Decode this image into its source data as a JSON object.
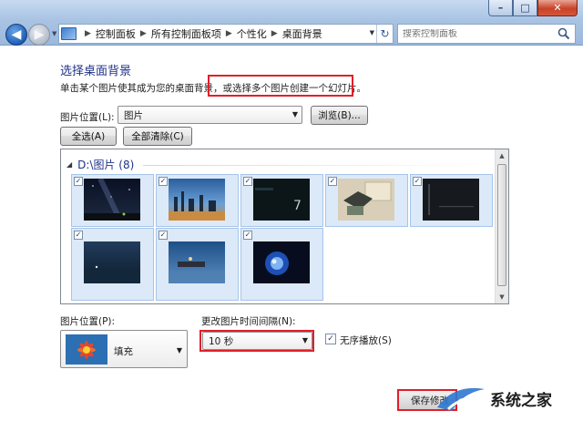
{
  "window": {
    "controls": [
      "–",
      "□",
      "✕"
    ]
  },
  "address_bar": {
    "breadcrumbs": [
      "控制面板",
      "所有控制面板项",
      "个性化",
      "桌面背景"
    ]
  },
  "search": {
    "placeholder": "搜索控制面板"
  },
  "page": {
    "title": "选择桌面背景",
    "subtitle_part1": "单击某个图片使其成为您的桌面背景，",
    "subtitle_part2": "或选择多个图片创建一个幻灯片。"
  },
  "picture_location": {
    "label": "图片位置(L):",
    "value": "图片",
    "browse_label": "浏览(B)..."
  },
  "select_buttons": {
    "select_all": "全选(A)",
    "clear_all": "全部清除(C)"
  },
  "gallery": {
    "group_title": "D:\\图片 (8)",
    "images": [
      {
        "name": "starry-night-wallpaper",
        "checked": true
      },
      {
        "name": "city-skyline-wallpaper",
        "checked": true
      },
      {
        "name": "windows-7-dark-wallpaper",
        "checked": true
      },
      {
        "name": "map-collage-wallpaper",
        "checked": true
      },
      {
        "name": "dark-abstract-wallpaper",
        "checked": true
      },
      {
        "name": "misty-lake-wallpaper",
        "checked": true
      },
      {
        "name": "pier-dusk-wallpaper",
        "checked": true
      },
      {
        "name": "blue-globe-wallpaper",
        "checked": true
      }
    ]
  },
  "picture_position": {
    "label": "图片位置(P):",
    "value": "填充"
  },
  "interval": {
    "label": "更改图片时间间隔(N):",
    "value": "10 秒"
  },
  "shuffle": {
    "label": "无序播放(S)",
    "checked": true
  },
  "footer": {
    "save_label": "保存修改"
  },
  "watermark": {
    "text": "系统之家"
  },
  "colors": {
    "title_blue": "#1e3287",
    "highlight_red": "#e0202a",
    "selection_bg": "#dce9f8"
  }
}
